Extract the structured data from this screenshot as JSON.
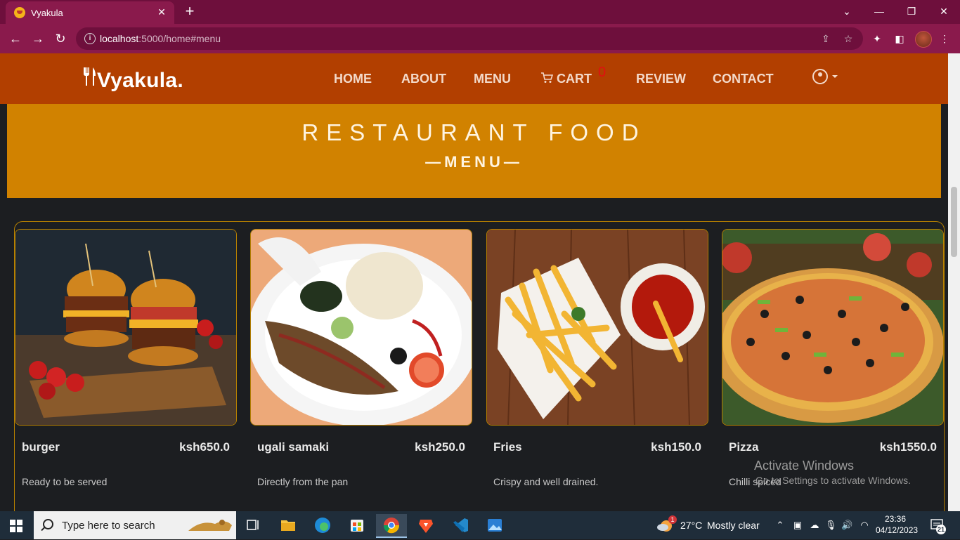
{
  "browser": {
    "tab_title": "Vyakula",
    "tab_close": "✕",
    "new_tab": "+",
    "url_host": "localhost",
    "url_rest": ":5000/home#menu",
    "window_controls": {
      "dropdown": "⌄",
      "minimize": "—",
      "restore": "❐",
      "close": "✕"
    }
  },
  "site": {
    "logo": "Vyakula.",
    "nav": [
      {
        "label": "HOME"
      },
      {
        "label": "ABOUT"
      },
      {
        "label": "MENU"
      },
      {
        "label": "CART"
      },
      {
        "label": "REVIEW"
      },
      {
        "label": "CONTACT"
      }
    ],
    "cart_count": "0",
    "banner_title": "RESTAURANT FOOD",
    "banner_subtitle": "—MENU—",
    "brand_color": "#b23f00",
    "banner_color": "#d18200"
  },
  "menu": {
    "items": [
      {
        "name": "burger",
        "price": "ksh650.0",
        "description": "Ready to be served",
        "image": "burger-photo"
      },
      {
        "name": "ugali samaki",
        "price": "ksh250.0",
        "description": "Directly from the pan",
        "image": "fish-ugali-photo"
      },
      {
        "name": "Fries",
        "price": "ksh150.0",
        "description": "Crispy and well drained.",
        "image": "fries-photo"
      },
      {
        "name": "Pizza",
        "price": "ksh1550.0",
        "description": "Chilli spiced",
        "image": "pizza-photo"
      }
    ]
  },
  "watermark": {
    "line1": "Activate Windows",
    "line2": "Go to Settings to activate Windows."
  },
  "taskbar": {
    "search_placeholder": "Type here to search",
    "weather_temp": "27°C",
    "weather_text": "Mostly clear",
    "weather_badge": "1",
    "time": "23:36",
    "date": "04/12/2023",
    "notification_count": "21",
    "apps": [
      "task-view",
      "file-explorer",
      "edge",
      "store",
      "chrome",
      "brave",
      "vscode",
      "photos"
    ]
  }
}
